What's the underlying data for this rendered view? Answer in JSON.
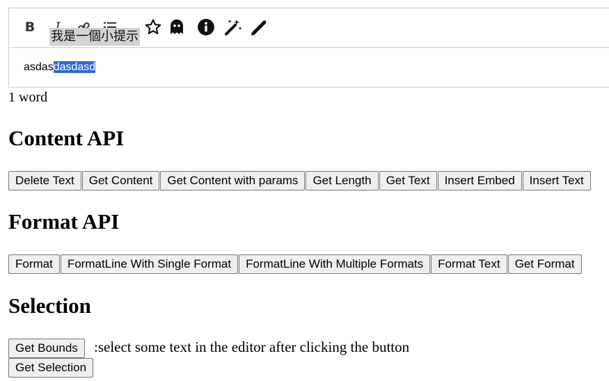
{
  "toolbar": {
    "buttons": [
      {
        "icon": "bold-icon",
        "label": "B"
      },
      {
        "icon": "italic-icon",
        "label": "I"
      },
      {
        "icon": "link-icon"
      },
      {
        "icon": "list-icon"
      },
      {
        "icon": "star-icon"
      },
      {
        "icon": "ghost-icon"
      },
      {
        "icon": "info-icon"
      },
      {
        "icon": "magic-wand-icon"
      },
      {
        "icon": "pen-icon"
      }
    ],
    "tooltip": "我是一個小提示"
  },
  "editor": {
    "text_unselected": "asdas",
    "text_selected": "dasdasd"
  },
  "word_count": "1 word",
  "content_api": {
    "heading": "Content API",
    "buttons": [
      "Delete Text",
      "Get Content",
      "Get Content with params",
      "Get Length",
      "Get Text",
      "Insert Embed",
      "Insert Text"
    ]
  },
  "format_api": {
    "heading": "Format API",
    "buttons": [
      "Format",
      "FormatLine With Single Format",
      "FormatLine With Multiple Formats",
      "Format Text",
      "Get Format"
    ]
  },
  "selection": {
    "heading": "Selection",
    "get_bounds_label": "Get Bounds",
    "hint": ":select some text in the editor after clicking the button",
    "get_selection_label": "Get Selection"
  }
}
